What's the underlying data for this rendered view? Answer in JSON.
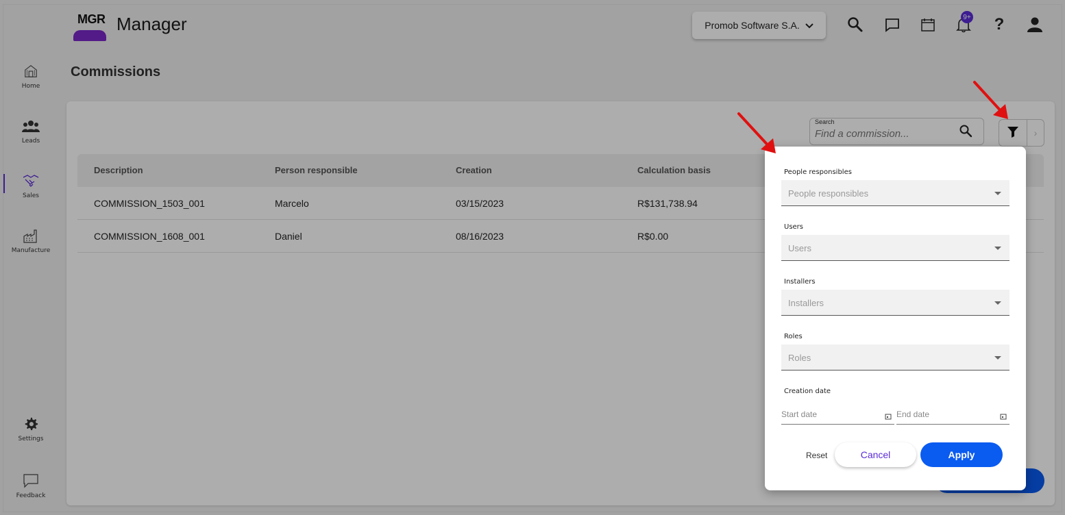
{
  "app": {
    "logo_text": "MGR",
    "title": "Manager",
    "company": "Promob Software S.A.",
    "notification_badge": "9+"
  },
  "sidebar": {
    "items": [
      {
        "label": "Home"
      },
      {
        "label": "Leads"
      },
      {
        "label": "Sales"
      },
      {
        "label": "Manufacture"
      },
      {
        "label": "Settings"
      },
      {
        "label": "Feedback"
      }
    ]
  },
  "page": {
    "title": "Commissions"
  },
  "search": {
    "label": "Search",
    "placeholder": "Find a commission..."
  },
  "table": {
    "headers": [
      "Description",
      "Person responsible",
      "Creation",
      "Calculation basis"
    ],
    "rows": [
      [
        "COMMISSION_1503_001",
        "Marcelo",
        "03/15/2023",
        "R$131,738.94"
      ],
      [
        "COMMISSION_1608_001",
        "Daniel",
        "08/16/2023",
        "R$0.00"
      ]
    ]
  },
  "filter_panel": {
    "people_label": "People responsibles",
    "people_placeholder": "People responsibles",
    "users_label": "Users",
    "users_placeholder": "Users",
    "installers_label": "Installers",
    "installers_placeholder": "Installers",
    "roles_label": "Roles",
    "roles_placeholder": "Roles",
    "creation_label": "Creation date",
    "start_placeholder": "Start date",
    "end_placeholder": "End date",
    "reset": "Reset",
    "cancel": "Cancel",
    "apply": "Apply"
  },
  "colors": {
    "accent": "#5b2bd6",
    "primary": "#0a5bf0",
    "annotation_arrow": "#e01010"
  }
}
